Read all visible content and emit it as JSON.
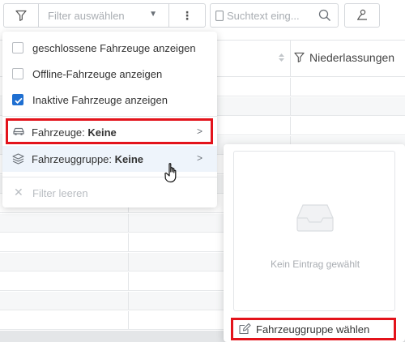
{
  "toolbar": {
    "filter_select_placeholder": "Filter auswählen",
    "more_label": "⋮",
    "search_placeholder": "Suchtext eing..."
  },
  "table": {
    "header_label": "Niederlassungen"
  },
  "menu": {
    "checkboxes": [
      {
        "label": "geschlossene Fahrzeuge anzeigen",
        "checked": false
      },
      {
        "label": "Offline-Fahrzeuge anzeigen",
        "checked": false
      },
      {
        "label": "Inaktive Fahrzeuge anzeigen",
        "checked": true
      }
    ],
    "vehicles": {
      "label": "Fahrzeuge: ",
      "value": "Keine"
    },
    "vehicle_group": {
      "label": "Fahrzeuggruppe: ",
      "value": "Keine"
    },
    "clear_label": "Filter leeren",
    "arrow": ">"
  },
  "panel": {
    "empty_text": "Kein Eintrag gewählt",
    "choose_button": "Fahrzeuggruppe wählen"
  },
  "colors": {
    "accent": "#1f6fd1",
    "highlight": "#e3131b",
    "hover": "#eef4fb"
  }
}
